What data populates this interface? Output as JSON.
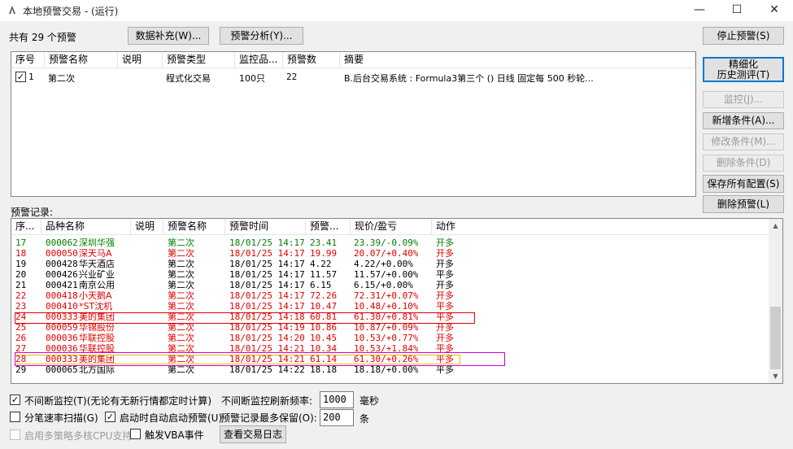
{
  "window": {
    "title": "本地预警交易 - (运行)",
    "minimize": "—",
    "maximize": "☐",
    "close": "✕"
  },
  "toolbar": {
    "count_label": "共有 29 个预警",
    "data_supplement": "数据补充(W)...",
    "alert_analysis": "预警分析(Y)..."
  },
  "side_buttons": {
    "stop": "停止预警(S)",
    "refined_line1": "精细化",
    "refined_line2": "历史测评(T)",
    "monitor": "监控(J)...",
    "add_condition": "新增条件(A)...",
    "edit_condition": "修改条件(M)...",
    "delete_condition": "删除条件(D)",
    "save_all": "保存所有配置(S)",
    "delete_alert": "删除预警(L)"
  },
  "alert_list": {
    "columns": [
      "序号",
      "预警名称",
      "说明",
      "预警类型",
      "监控品...",
      "预警数",
      "摘要"
    ],
    "rows": [
      {
        "checked": "✓",
        "id": "1",
        "name": "第二次",
        "desc": "",
        "type": "程式化交易",
        "monitor": "100只",
        "count": "22",
        "summary": "B.后台交易系统 : Formula3第三个 () 日线 固定每 500 秒轮..."
      }
    ]
  },
  "records": {
    "label": "预警记录:",
    "columns": [
      "序...",
      "品种名称",
      "说明",
      "预警名称",
      "预警时间",
      "预警...",
      "现价/盈亏",
      "动作"
    ],
    "rows": [
      {
        "id": "17",
        "code": "000062",
        "name": "深圳华强",
        "desc": "",
        "alert": "第二次",
        "time": "18/01/25 14:17",
        "price": "23.41",
        "pnl": "23.39/-0.09%",
        "action": "开多",
        "color": "#008000"
      },
      {
        "id": "18",
        "code": "000050",
        "name": "深天马A",
        "desc": "",
        "alert": "第二次",
        "time": "18/01/25 14:17",
        "price": "19.99",
        "pnl": "20.07/+0.40%",
        "action": "开多",
        "color": "#e00000"
      },
      {
        "id": "19",
        "code": "000428",
        "name": "华天酒店",
        "desc": "",
        "alert": "第二次",
        "time": "18/01/25 14:17",
        "price": "4.22",
        "pnl": "4.22/+0.00%",
        "action": "开多",
        "color": "#000000"
      },
      {
        "id": "20",
        "code": "000426",
        "name": "兴业矿业",
        "desc": "",
        "alert": "第二次",
        "time": "18/01/25 14:17",
        "price": "11.57",
        "pnl": "11.57/+0.00%",
        "action": "平多",
        "color": "#000000"
      },
      {
        "id": "21",
        "code": "000421",
        "name": "南京公用",
        "desc": "",
        "alert": "第二次",
        "time": "18/01/25 14:17",
        "price": "6.15",
        "pnl": "6.15/+0.00%",
        "action": "开多",
        "color": "#000000"
      },
      {
        "id": "22",
        "code": "000418",
        "name": "小天鹅A",
        "desc": "",
        "alert": "第二次",
        "time": "18/01/25 14:17",
        "price": "72.26",
        "pnl": "72.31/+0.07%",
        "action": "开多",
        "color": "#e00000"
      },
      {
        "id": "23",
        "code": "000410",
        "name": "*ST沈机",
        "desc": "",
        "alert": "第二次",
        "time": "18/01/25 14:17",
        "price": "10.47",
        "pnl": "10.48/+0.10%",
        "action": "平多",
        "color": "#e00000"
      },
      {
        "id": "24",
        "code": "000333",
        "name": "美的集团",
        "desc": "",
        "alert": "第二次",
        "time": "18/01/25 14:18",
        "price": "60.81",
        "pnl": "61.30/+0.81%",
        "action": "平多",
        "color": "#e00000"
      },
      {
        "id": "25",
        "code": "000059",
        "name": "华锦股份",
        "desc": "",
        "alert": "第二次",
        "time": "18/01/25 14:19",
        "price": "10.86",
        "pnl": "10.87/+0.09%",
        "action": "开多",
        "color": "#e00000"
      },
      {
        "id": "26",
        "code": "000036",
        "name": "华联控股",
        "desc": "",
        "alert": "第二次",
        "time": "18/01/25 14:20",
        "price": "10.45",
        "pnl": "10.53/+0.77%",
        "action": "开多",
        "color": "#e00000"
      },
      {
        "id": "27",
        "code": "000036",
        "name": "华联控股",
        "desc": "",
        "alert": "第二次",
        "time": "18/01/25 14:21",
        "price": "10.34",
        "pnl": "10.53/+1.84%",
        "action": "平多",
        "color": "#e00000"
      },
      {
        "id": "28",
        "code": "000333",
        "name": "美的集团",
        "desc": "",
        "alert": "第二次",
        "time": "18/01/25 14:21",
        "price": "61.14",
        "pnl": "61.30/+0.26%",
        "action": "平多",
        "color": "#e00000"
      },
      {
        "id": "29",
        "code": "000065",
        "name": "北方国际",
        "desc": "",
        "alert": "第二次",
        "time": "18/01/25 14:22",
        "price": "18.18",
        "pnl": "18.18/+0.00%",
        "action": "平多",
        "color": "#000000"
      }
    ]
  },
  "options": {
    "continuous_monitor": "不间断监控(T)(无论有无新行情都定时计算)",
    "continuous_monitor_checked": "✓",
    "refresh_label": "不间断监控刷新频率:",
    "refresh_value": "1000",
    "refresh_unit": "毫秒",
    "tick_scan": "分笔速率扫描(G)",
    "tick_scan_checked": "",
    "auto_start": "启动时自动启动预警(U)",
    "auto_start_checked": "✓",
    "keep_label": "预警记录最多保留(O):",
    "keep_value": "200",
    "keep_unit": "条",
    "multicore": "启用多策略多核CPU支持",
    "multicore_checked": "",
    "vba_event": "触发VBA事件",
    "vba_event_checked": "",
    "view_log": "查看交易日志"
  }
}
